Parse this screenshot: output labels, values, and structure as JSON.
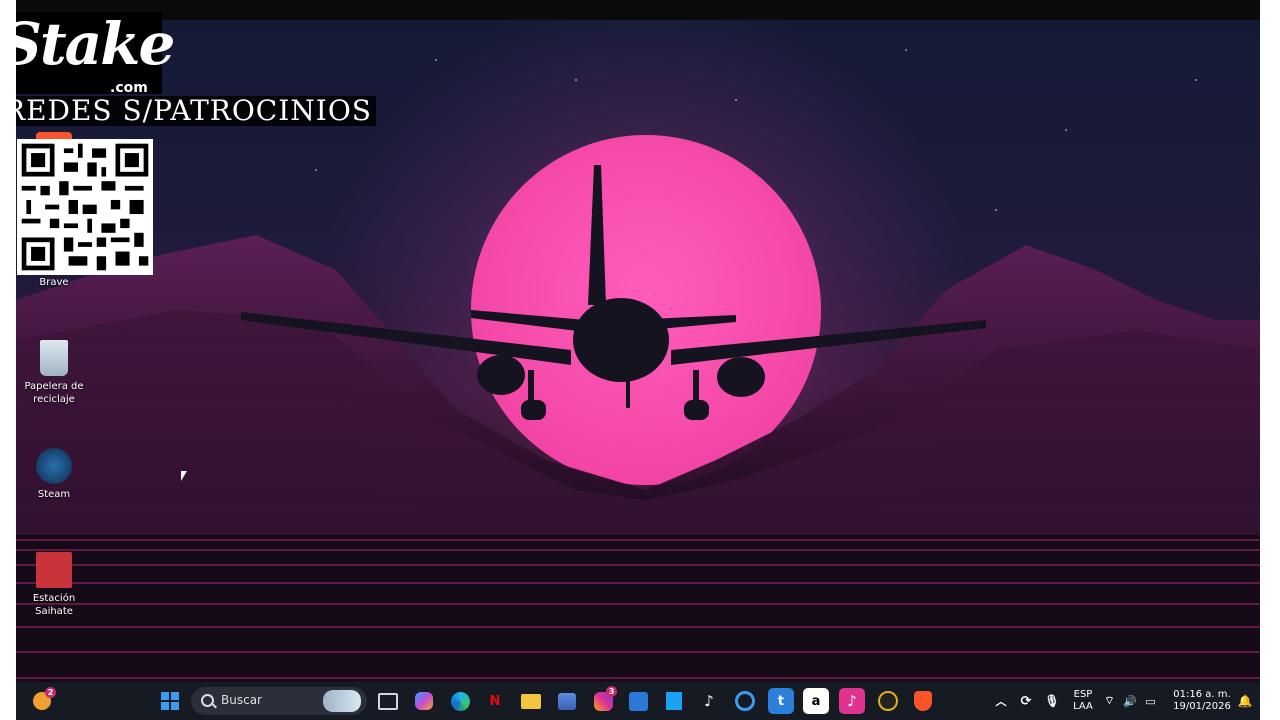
{
  "overlay": {
    "brand": "Stake",
    "brand_sub": ".com",
    "banner": "REDES S/PATROCINIOS"
  },
  "desktop_icons": [
    {
      "label": "Brave",
      "icon": "brave-icon"
    },
    {
      "label": "Papelera de reciclaje",
      "icon": "recycle-bin-icon"
    },
    {
      "label": "Steam",
      "icon": "steam-icon"
    },
    {
      "label": "Estación Saihate",
      "icon": "saihate-icon"
    }
  ],
  "taskbar": {
    "search_placeholder": "Buscar",
    "weather_badge": "2",
    "instagram_badge": "3",
    "apps": [
      "start-icon",
      "task-view-icon",
      "copilot-icon",
      "edge-icon",
      "netflix-icon",
      "file-explorer-icon",
      "store-icon",
      "instagram-icon",
      "vscode-icon",
      "ms-store-blue-icon",
      "tiktok-icon",
      "cortana-ring-icon",
      "tumblr-icon",
      "amazon-icon",
      "tiktok-pink-icon",
      "obs-icon",
      "brave-icon"
    ],
    "lang_top": "ESP",
    "lang_bottom": "LAA",
    "time": "01:16 a. m.",
    "date": "19/01/2026"
  },
  "colors": {
    "sun": "#ff4fb4",
    "taskbar": "#161a22",
    "accent_pink": "#e0338f"
  }
}
